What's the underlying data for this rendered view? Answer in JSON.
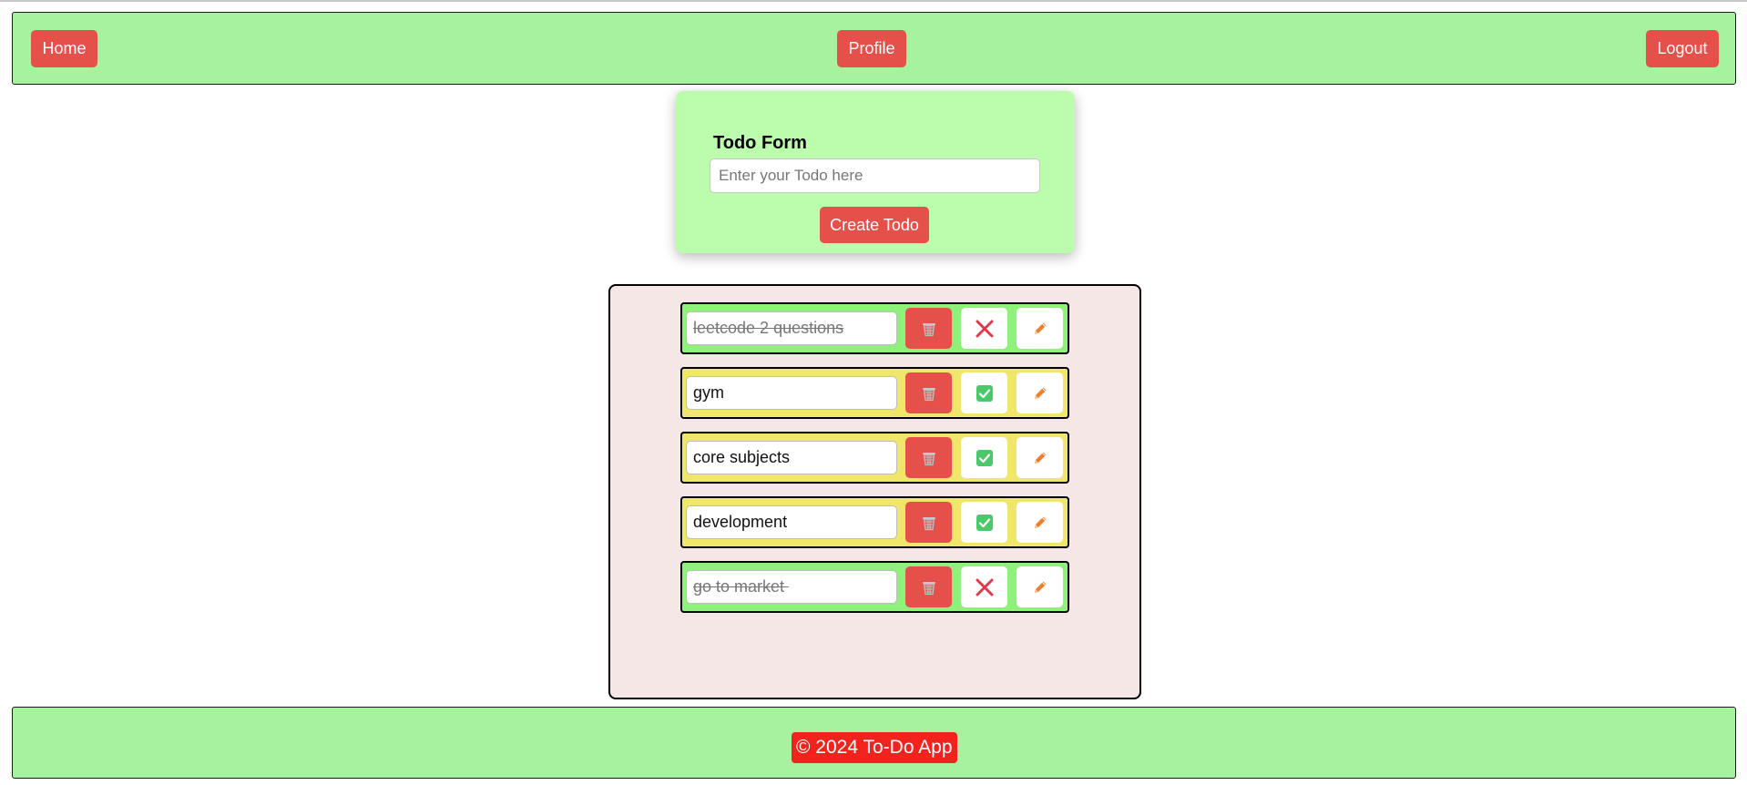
{
  "nav": {
    "home_label": "Home",
    "profile_label": "Profile",
    "logout_label": "Logout"
  },
  "form": {
    "title": "Todo Form",
    "input_placeholder": "Enter your Todo here",
    "input_value": "",
    "submit_label": "Create Todo"
  },
  "todos": [
    {
      "text": "leetcode 2 questions",
      "completed": true,
      "toggle_icon": "x-icon"
    },
    {
      "text": "gym",
      "completed": false,
      "toggle_icon": "checkbox-check-icon"
    },
    {
      "text": "core subjects",
      "completed": false,
      "toggle_icon": "checkbox-check-icon"
    },
    {
      "text": "development",
      "completed": false,
      "toggle_icon": "checkbox-check-icon"
    },
    {
      "text": "go to market ",
      "completed": true,
      "toggle_icon": "x-icon"
    }
  ],
  "icons": {
    "delete": "wastebasket-icon",
    "edit": "pencil-icon"
  },
  "footer": {
    "text": "© 2024 To-Do App"
  },
  "colors": {
    "bar_green": "#a6f29e",
    "form_green": "#bcfcad",
    "button_red": "#e5504a",
    "completed_row": "#8ef27a",
    "pending_row": "#f0e76a",
    "list_bg": "#f5e7e6",
    "footer_badge": "#f2231c"
  }
}
